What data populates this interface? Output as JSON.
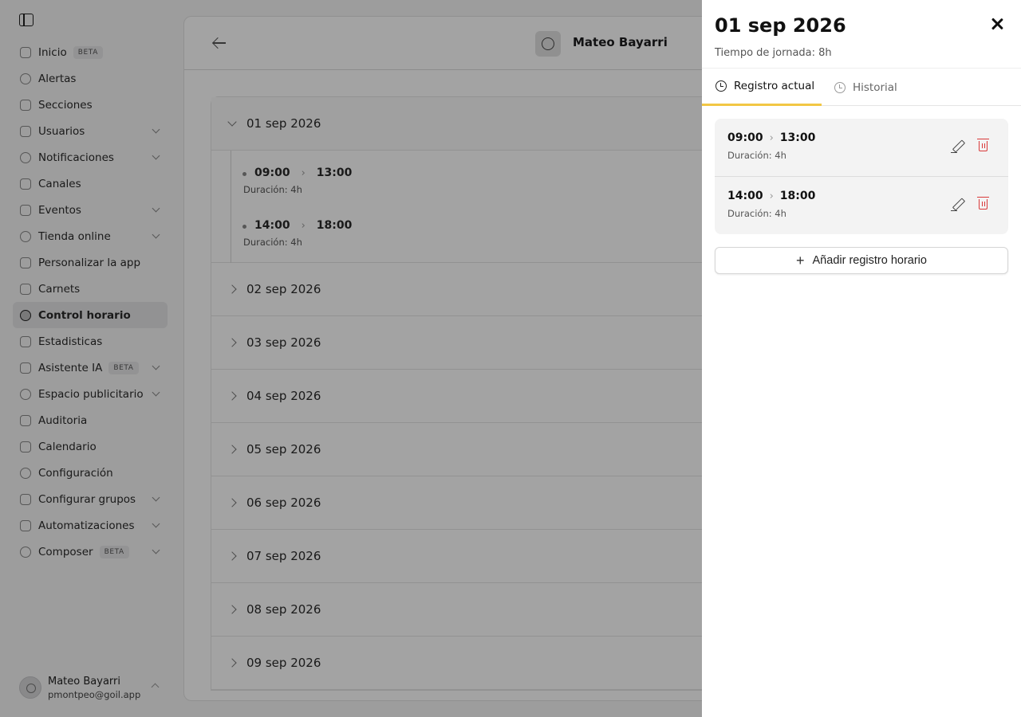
{
  "sidebar": {
    "items": [
      {
        "label": "Inicio",
        "badge": "BETA",
        "chevron": false,
        "icon": "home-icon"
      },
      {
        "label": "Alertas",
        "badge": "",
        "chevron": false,
        "icon": "bell-icon"
      },
      {
        "label": "Secciones",
        "badge": "",
        "chevron": false,
        "icon": "sections-icon"
      },
      {
        "label": "Usuarios",
        "badge": "",
        "chevron": true,
        "icon": "users-icon"
      },
      {
        "label": "Notificaciones",
        "badge": "",
        "chevron": true,
        "icon": "chat-icon"
      },
      {
        "label": "Canales",
        "badge": "",
        "chevron": false,
        "icon": "megaphone-icon"
      },
      {
        "label": "Eventos",
        "badge": "",
        "chevron": true,
        "icon": "ticket-icon"
      },
      {
        "label": "Tienda online",
        "badge": "",
        "chevron": true,
        "icon": "store-icon"
      },
      {
        "label": "Personalizar la app",
        "badge": "",
        "chevron": false,
        "icon": "palette-icon"
      },
      {
        "label": "Carnets",
        "badge": "",
        "chevron": false,
        "icon": "card-icon"
      },
      {
        "label": "Control horario",
        "badge": "",
        "chevron": false,
        "icon": "clock-icon",
        "active": true
      },
      {
        "label": "Estadisticas",
        "badge": "",
        "chevron": false,
        "icon": "chart-icon"
      },
      {
        "label": "Asistente IA",
        "badge": "BETA",
        "chevron": true,
        "icon": "sparkle-icon"
      },
      {
        "label": "Espacio publicitario",
        "badge": "",
        "chevron": true,
        "icon": "phone-icon"
      },
      {
        "label": "Auditoria",
        "badge": "",
        "chevron": false,
        "icon": "document-icon"
      },
      {
        "label": "Calendario",
        "badge": "",
        "chevron": false,
        "icon": "calendar-icon"
      },
      {
        "label": "Configuración",
        "badge": "",
        "chevron": false,
        "icon": "gear-icon"
      },
      {
        "label": "Configurar grupos",
        "badge": "",
        "chevron": true,
        "icon": "group-icon"
      },
      {
        "label": "Automatizaciones",
        "badge": "",
        "chevron": true,
        "icon": "automation-icon"
      },
      {
        "label": "Composer",
        "badge": "BETA",
        "chevron": true,
        "icon": "composer-icon"
      }
    ],
    "user": {
      "name": "Mateo Bayarri",
      "email": "pmontpeo@goil.app"
    }
  },
  "main": {
    "employee_name": "Mateo Bayarri",
    "days": [
      {
        "label": "01 sep 2026",
        "open": true,
        "entries": [
          {
            "start": "09:00",
            "end": "13:00",
            "duration": "Duración: 4h"
          },
          {
            "start": "14:00",
            "end": "18:00",
            "duration": "Duración: 4h"
          }
        ]
      },
      {
        "label": "02 sep 2026",
        "open": false
      },
      {
        "label": "03 sep 2026",
        "open": false
      },
      {
        "label": "04 sep 2026",
        "open": false
      },
      {
        "label": "05 sep 2026",
        "open": false
      },
      {
        "label": "06 sep 2026",
        "open": false
      },
      {
        "label": "07 sep 2026",
        "open": false
      },
      {
        "label": "08 sep 2026",
        "open": false
      },
      {
        "label": "09 sep 2026",
        "open": false
      }
    ]
  },
  "drawer": {
    "title": "01 sep 2026",
    "subtitle": "Tiempo de jornada: 8h",
    "tabs": {
      "current": "Registro actual",
      "history": "Historial"
    },
    "records": [
      {
        "start": "09:00",
        "end": "13:00",
        "duration": "Duración: 4h"
      },
      {
        "start": "14:00",
        "end": "18:00",
        "duration": "Duración: 4h"
      }
    ],
    "add_label": "Añadir registro horario",
    "accent": "#f2c744",
    "danger": "#d93a3a"
  }
}
